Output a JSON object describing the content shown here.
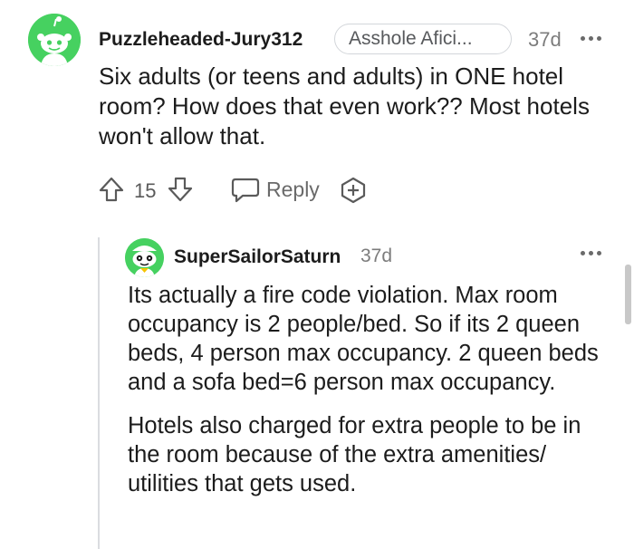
{
  "comment": {
    "username": "Puzzleheaded-Jury312",
    "flair": "Asshole Afici...",
    "time": "37d",
    "body": "Six adults (or teens and adults) in ONE hotel room? How does that even work?? Most hotels won't allow that.",
    "votes": "15",
    "reply_label": "Reply",
    "colors": {
      "avatar_bg": "#46d160",
      "text": "#1c1c1c",
      "muted": "#7c7c7c"
    }
  },
  "reply": {
    "username": "SuperSailorSaturn",
    "time": "37d",
    "paragraphs": [
      "Its actually a fire code violation. Max room occupancy is 2 people/bed. So if its 2 queen beds, 4 person max occupancy. 2 queen beds and a sofa bed=6 person max occupancy.",
      "Hotels also charged for extra people to be in the room because of the extra amenities/ utilities that gets used."
    ]
  },
  "icons": {
    "avatar": "reddit-snoo-avatar-icon",
    "more": "more-options-icon",
    "upvote": "upvote-arrow-icon",
    "downvote": "downvote-arrow-icon",
    "reply": "reply-bubble-icon",
    "award": "award-plus-icon"
  }
}
